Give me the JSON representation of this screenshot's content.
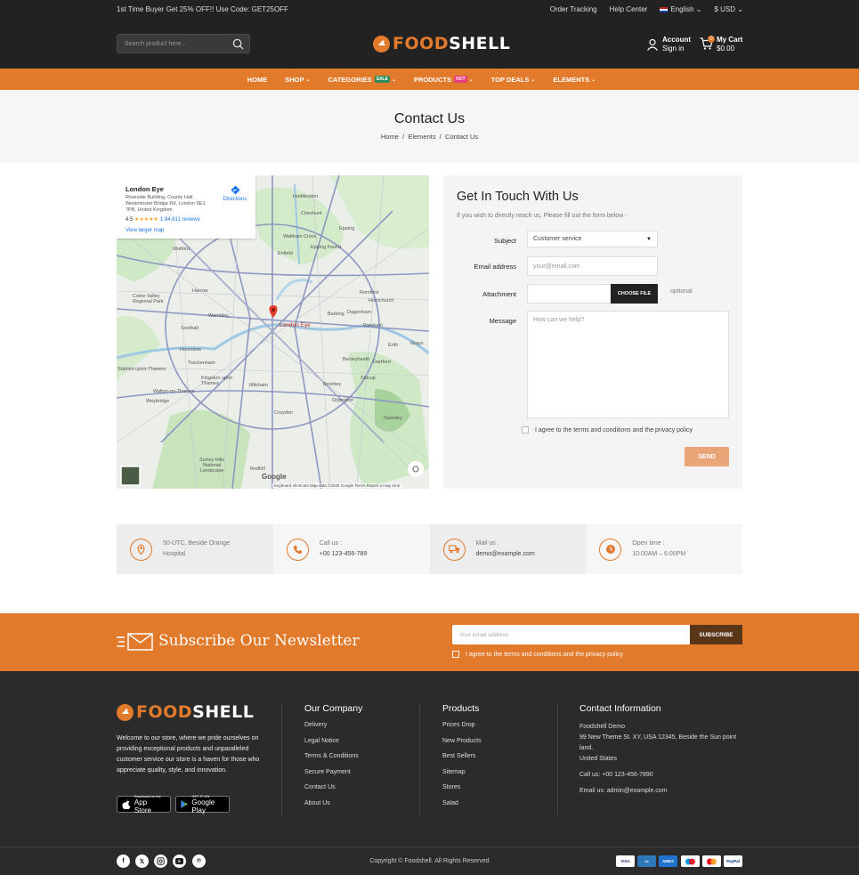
{
  "topbar": {
    "promo": "1st Time Buyer Get 25% OFF!! Use Code: GET25OFF",
    "order_tracking": "Order Tracking",
    "help_center": "Help Center",
    "language": "English",
    "currency": "$ USD"
  },
  "header": {
    "search_placeholder": "Search product here...",
    "logo_part1": "FOOD",
    "logo_part2": "SHELL",
    "account_label": "Account",
    "account_sub": "Sign in",
    "cart_label": "My Cart",
    "cart_total": "$0.00",
    "cart_count": "0"
  },
  "nav": {
    "items": [
      {
        "label": "HOME"
      },
      {
        "label": "SHOP"
      },
      {
        "label": "CATEGORIES",
        "tag": "SALE"
      },
      {
        "label": "PRODUCTS",
        "tag": "HOT"
      },
      {
        "label": "TOP DEALS"
      },
      {
        "label": "ELEMENTS"
      }
    ]
  },
  "page": {
    "title": "Contact Us",
    "breadcrumb": [
      "Home",
      "Elements",
      "Contact Us"
    ]
  },
  "map": {
    "place": "London Eye",
    "address": "Riverside Building, County Hall, Westminster Bridge Rd, London SE1 7PB, United Kingdom",
    "rating": "4.5",
    "stars": "★★★★★",
    "reviews": "1,94,611 reviews",
    "larger": "View larger map",
    "directions": "Directions",
    "pin_label": "London Eye",
    "footer": "Keyboard shortcuts   Map data ©2025 Google   Terms   Report a map error",
    "google": "Google",
    "labels": [
      "Hoddesdon",
      "Cheshunt",
      "Waltham Cross",
      "Epping",
      "Enfield",
      "Epping Forest",
      "Watford",
      "Harrow",
      "Wembley",
      "Romford",
      "Hornchurch",
      "Barking",
      "Dagenham",
      "Southall",
      "Hounslow",
      "Twickenham",
      "Kingston upon Thames",
      "Mitcham",
      "Croydon",
      "Bromley",
      "Bexleyheath",
      "Dartford",
      "Grays",
      "Orpington",
      "Weybridge",
      "Surrey Hills National Landscape",
      "Redhill",
      "Colne Valley Regional Park",
      "Staines-upon-Thames",
      "Walton-on-Thames",
      "Rainham",
      "Sidcup",
      "Swanley",
      "Erith"
    ]
  },
  "form": {
    "title": "Get In Touch With Us",
    "subtitle": "If you wish to directly reach us, Please fill out the form below -",
    "subject_label": "Subject",
    "subject_value": "Customer service",
    "email_label": "Email address",
    "email_placeholder": "your@email.com",
    "attachment_label": "Attachment",
    "choose_file": "CHOOSE FILE",
    "optional": "optional",
    "message_label": "Message",
    "message_placeholder": "How can we help?",
    "agree": "I agree to the terms and conditions and the privacy policy",
    "send": "SEND"
  },
  "info": [
    {
      "title": "50-UTC, Beside Orange",
      "value": "Hospital",
      "icon": "location-icon"
    },
    {
      "title": "Call us :",
      "value": "+00 123-456-789",
      "icon": "phone-icon"
    },
    {
      "title": "Mail us :",
      "value": "demo@example.com",
      "icon": "truck-icon"
    },
    {
      "title": "Open time :",
      "value": "10:00AM – 6:00PM",
      "icon": "clock-icon"
    }
  ],
  "newsletter": {
    "title": "Subscribe Our Newsletter",
    "placeholder": "Your email address",
    "button": "SUBSCRIBE",
    "agree": "I agree to the terms and conditions and the privacy policy"
  },
  "footer": {
    "about": "Welcome to our store, where we pride ourselves on providing exceptional products and unparalleled customer service our store is a haven for those who appreciate quality, style, and innovation.",
    "appstore_small": "Download on the",
    "appstore": "App Store",
    "googleplay_small": "GET IT ON",
    "googleplay": "Google Play",
    "company_title": "Our Company",
    "company": [
      "Delivery",
      "Legal Notice",
      "Terms & Conditions",
      "Secure Payment",
      "Contact Us",
      "About Us"
    ],
    "products_title": "Products",
    "products": [
      "Prices Drop",
      "New Products",
      "Best Sellers",
      "Sitemap",
      "Stores",
      "Salad"
    ],
    "contact_title": "Contact Information",
    "contact_name": "Foodshell Demo",
    "contact_address": "99 New Theme St. XY, USA 12345, Beside the Sun point land.",
    "contact_country": "United States",
    "contact_phone": "Call us: +00 123-456-7890",
    "contact_email": "Email us: admin@example.com",
    "copyright": "Copyright © Foodshell. All Rights Reserved",
    "payments": [
      "VISA",
      "AMEX",
      "MC",
      "PayPal"
    ]
  }
}
